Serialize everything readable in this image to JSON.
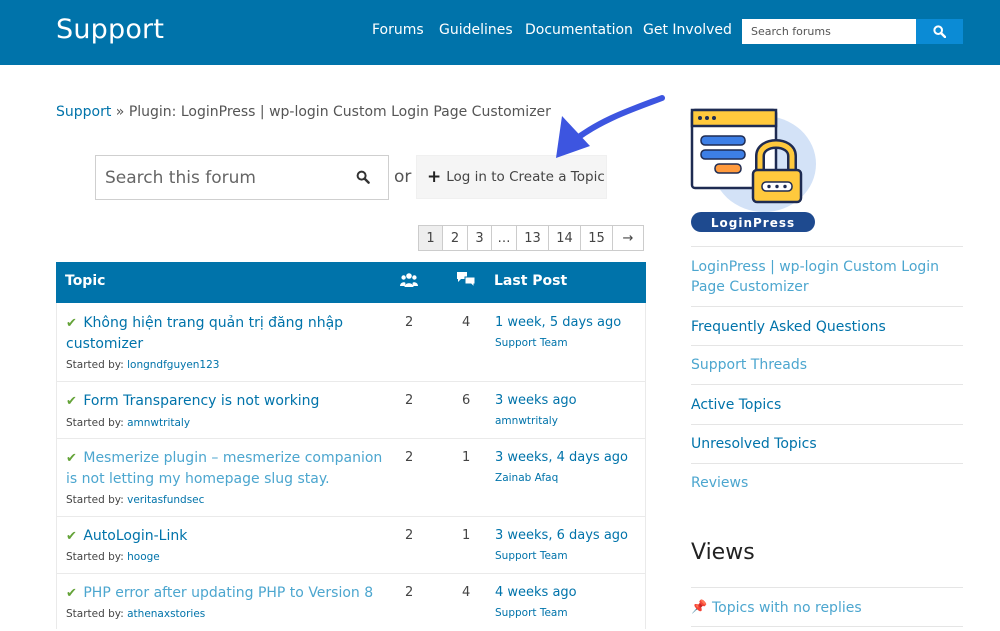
{
  "header": {
    "brand": "Support",
    "nav": [
      "Forums",
      "Guidelines",
      "Documentation",
      "Get Involved"
    ],
    "search_placeholder": "Search forums"
  },
  "breadcrumb": {
    "root": "Support",
    "separator": "»",
    "current": "Plugin: LoginPress | wp-login Custom Login Page Customizer"
  },
  "forum_search": {
    "placeholder": "Search this forum",
    "or": "or",
    "create_label": "Log in to Create a Topic"
  },
  "pagination": [
    "1",
    "2",
    "3",
    "…",
    "13",
    "14",
    "15",
    "→"
  ],
  "table": {
    "headers": {
      "topic": "Topic",
      "last_post": "Last Post"
    },
    "started_by_label": "Started by:",
    "rows": [
      {
        "title": "Không hiện trang quản trị đăng nhập customizer",
        "author": "longndfguyen123",
        "voices": "2",
        "posts": "4",
        "last_time": "1 week, 5 days ago",
        "last_by": "Support Team"
      },
      {
        "title": "Form Transparency is not working",
        "author": "amnwtritaly",
        "voices": "2",
        "posts": "6",
        "last_time": "3 weeks ago",
        "last_by": "amnwtritaly"
      },
      {
        "title": "Mesmerize plugin – mesmerize companion is not letting my homepage slug stay.",
        "author": "veritasfundsec",
        "voices": "2",
        "posts": "1",
        "last_time": "3 weeks, 4 days ago",
        "last_by": "Zainab Afaq"
      },
      {
        "title": "AutoLogin-Link",
        "author": "hooge",
        "voices": "2",
        "posts": "1",
        "last_time": "3 weeks, 6 days ago",
        "last_by": "Support Team"
      },
      {
        "title": "PHP error after updating PHP to Version 8",
        "author": "athenaxstories",
        "voices": "2",
        "posts": "4",
        "last_time": "4 weeks ago",
        "last_by": "Support Team"
      }
    ]
  },
  "sidebar": {
    "logo_text": "LoginPress",
    "links": [
      "LoginPress | wp-login Custom Login Page Customizer",
      "Frequently Asked Questions",
      "Support Threads",
      "Active Topics",
      "Unresolved Topics",
      "Reviews"
    ],
    "views_title": "Views",
    "views_links": [
      "Topics with no replies"
    ]
  },
  "colors": {
    "brand_blue": "#0073aa",
    "link_blue": "#0073aa",
    "arrow_blue": "#3d55e0",
    "check_green": "#64a338"
  }
}
